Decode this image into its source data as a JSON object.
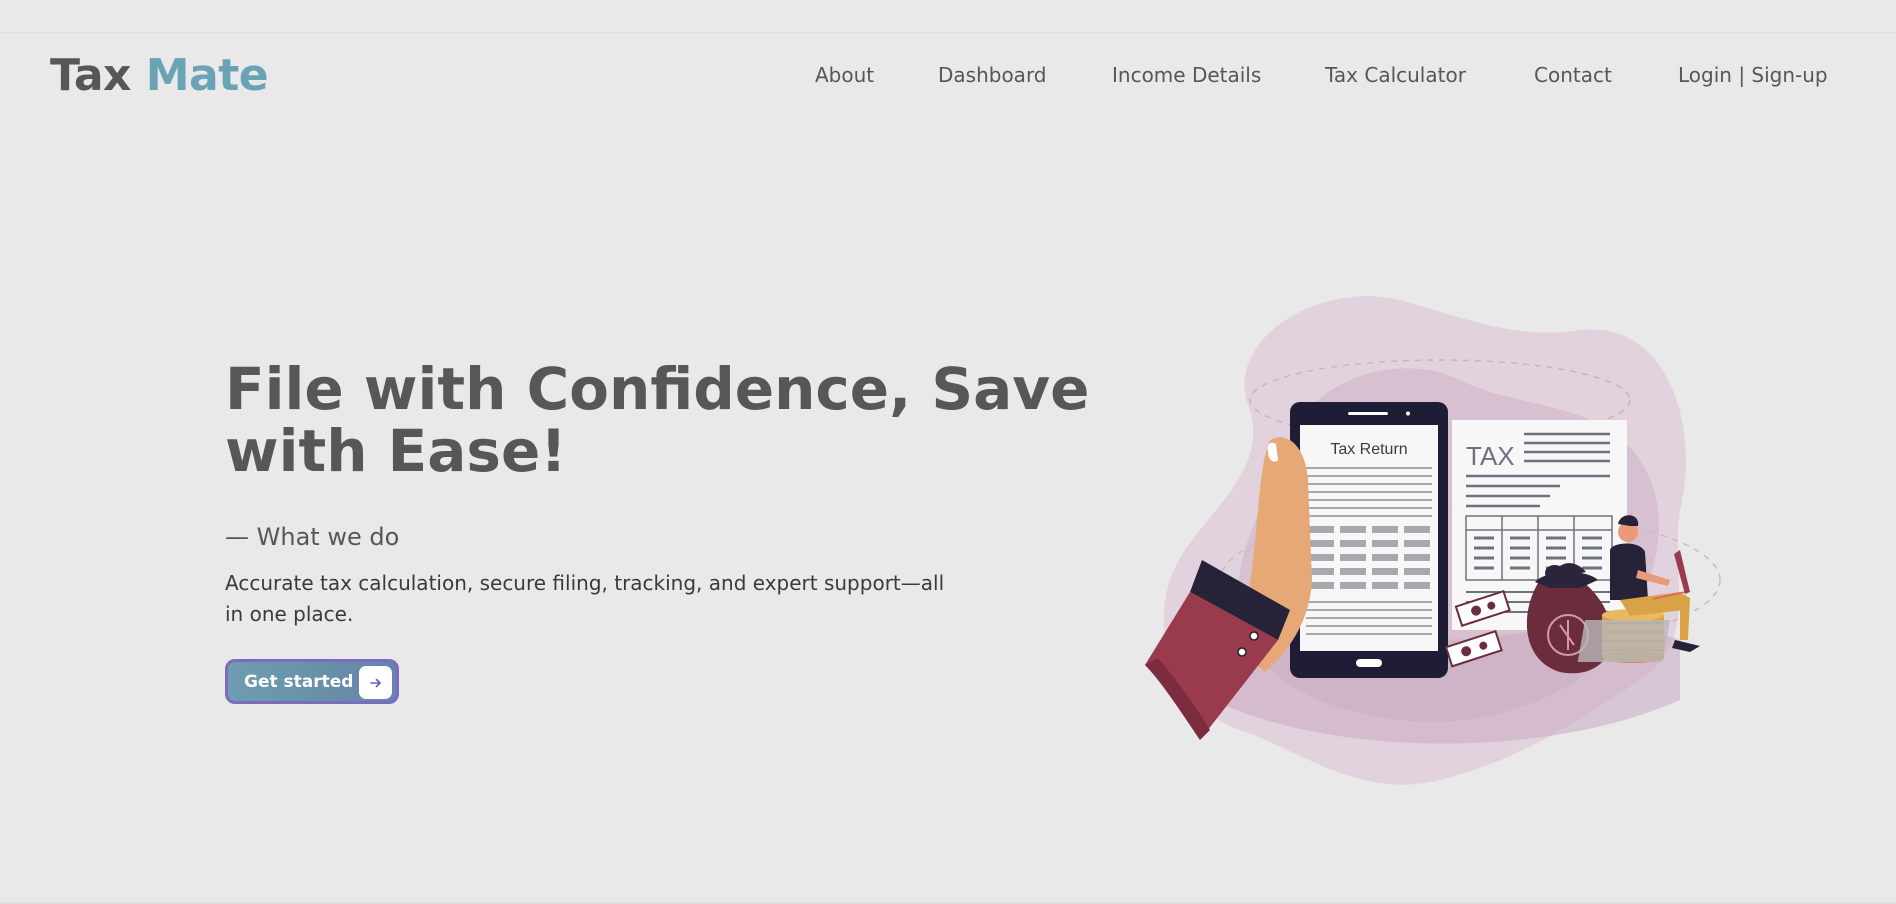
{
  "brand": {
    "part1": "Tax",
    "part2": "Mate",
    "color_primary": "#555857",
    "color_accent": "#6aa3b6"
  },
  "nav": {
    "items": [
      {
        "label": "About"
      },
      {
        "label": "Dashboard"
      },
      {
        "label": "Income Details"
      },
      {
        "label": "Tax Calculator"
      },
      {
        "label": "Contact"
      },
      {
        "label": "Login | Sign-up"
      }
    ]
  },
  "hero": {
    "title": "File with Confidence, Save with Ease!",
    "kicker": "— What we do",
    "description": "Accurate tax calculation, secure filing, tracking, and expert support—all in one place.",
    "cta_label": "Get started",
    "cta_icon": "arrow-right-icon"
  },
  "illustration": {
    "phone_title": "Tax Return",
    "doc_title": "TAX",
    "icons": [
      "hand-holding-phone",
      "tax-document",
      "money-bag",
      "coin-stack",
      "banknotes",
      "person-with-laptop"
    ]
  }
}
